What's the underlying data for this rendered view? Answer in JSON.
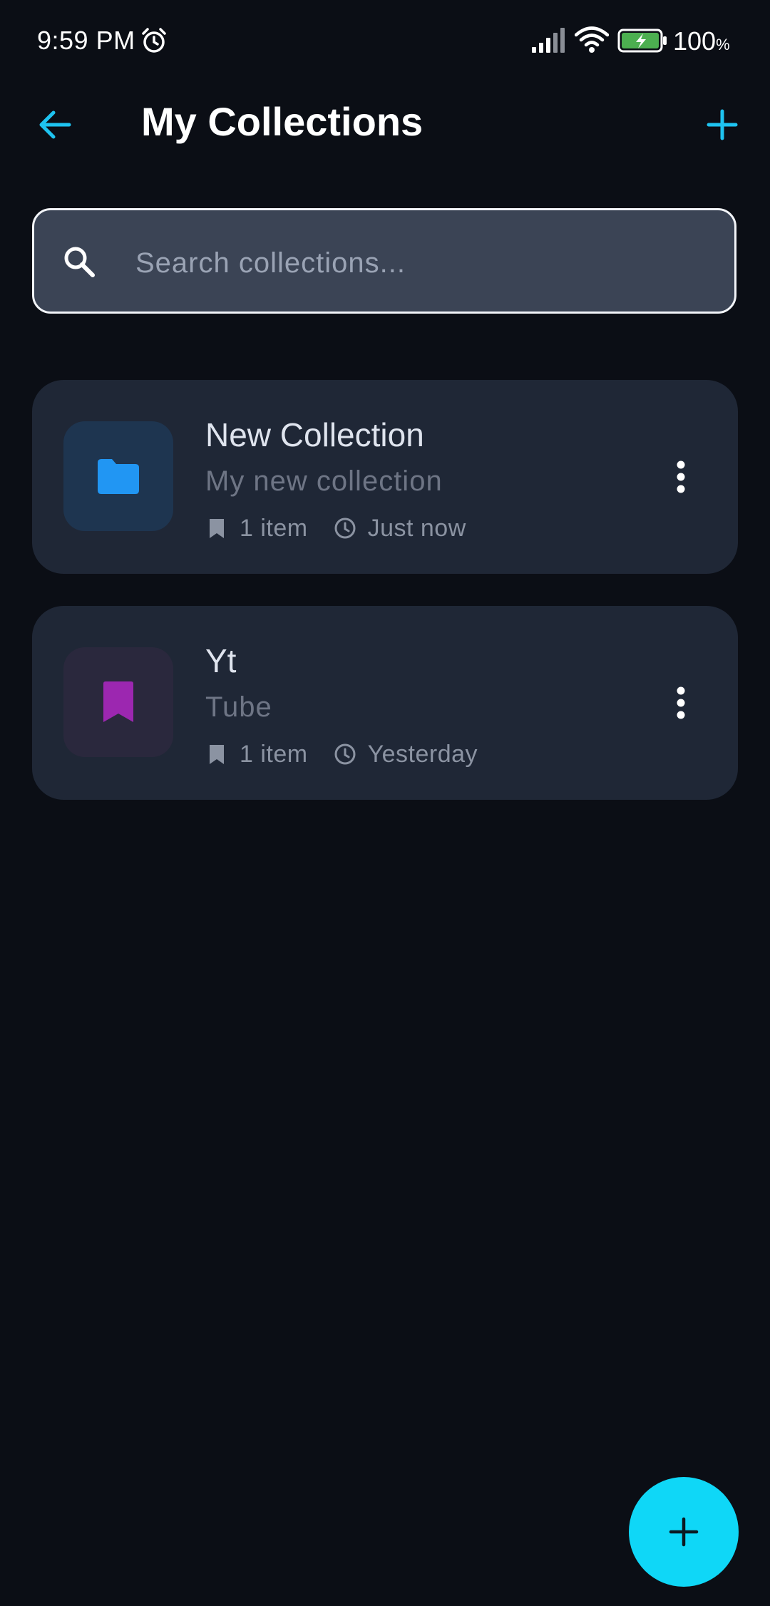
{
  "status_bar": {
    "time": "9:59 PM",
    "battery": "100",
    "battery_unit": "%"
  },
  "header": {
    "title": "My Collections",
    "back_icon": "arrow-left-icon",
    "add_icon": "plus-icon"
  },
  "search": {
    "placeholder": "Search collections...",
    "value": ""
  },
  "collections": [
    {
      "title": "New Collection",
      "description": "My new collection",
      "items": "1 item",
      "updated": "Just now",
      "icon": "folder-icon",
      "icon_color": "#2196f3",
      "tile_color": "#1e3550"
    },
    {
      "title": "Yt",
      "description": "Tube",
      "items": "1 item",
      "updated": "Yesterday",
      "icon": "bookmark-icon",
      "icon_color": "#9c27b0",
      "tile_color": "#2a283d"
    }
  ],
  "colors": {
    "accent": "#1ec3f0",
    "fab": "#0fd7f7",
    "background": "#0b0e15",
    "card": "#1f2736"
  }
}
